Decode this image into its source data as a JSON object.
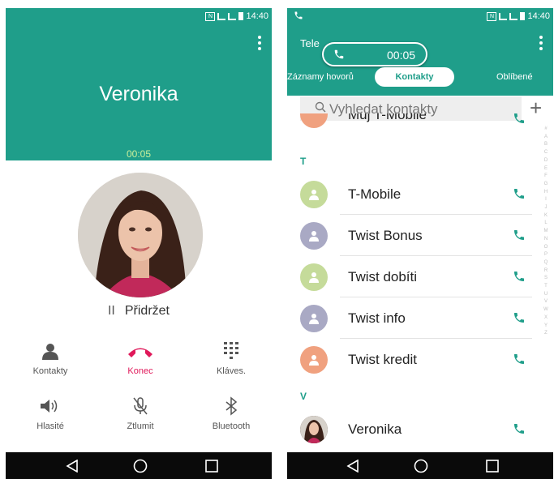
{
  "status": {
    "time": "14:40",
    "nfc": "N"
  },
  "call_screen": {
    "caller_name": "Veronika",
    "call_timer": "00:05",
    "hold_label": "Přidržet",
    "actions": [
      {
        "label": "Kontakty",
        "icon": "person-icon",
        "color": "#555555"
      },
      {
        "label": "Konec",
        "icon": "end-call-icon",
        "color": "#e0195a"
      },
      {
        "label": "Kláves.",
        "icon": "dialpad-icon",
        "color": "#555555"
      },
      {
        "label": "Hlasité",
        "icon": "speaker-icon",
        "color": "#555555"
      },
      {
        "label": "Ztlumit",
        "icon": "mute-mic-icon",
        "color": "#555555"
      },
      {
        "label": "Bluetooth",
        "icon": "bluetooth-icon",
        "color": "#555555"
      }
    ]
  },
  "contacts_screen": {
    "title": "Tele",
    "ongoing_call_timer": "00:05",
    "tabs": [
      "Záznamy hovorů",
      "Kontakty",
      "Oblíbené"
    ],
    "active_tab": "Kontakty",
    "search_placeholder": "Vyhledat kontakty",
    "partial_contact": "Můj T-Mobile",
    "sections": [
      {
        "letter": "T",
        "contacts": [
          {
            "name": "T-Mobile",
            "avatar_color": "#c5db9a"
          },
          {
            "name": "Twist Bonus",
            "avatar_color": "#a9a9c4"
          },
          {
            "name": "Twist dobíti",
            "avatar_color": "#c5db9a"
          },
          {
            "name": "Twist info",
            "avatar_color": "#a9a9c4"
          },
          {
            "name": "Twist kredit",
            "avatar_color": "#f0a17f"
          }
        ]
      },
      {
        "letter": "V",
        "contacts": [
          {
            "name": "Veronika",
            "avatar_color": "photo"
          }
        ]
      }
    ],
    "index_letters": [
      "#",
      "A",
      "B",
      "C",
      "D",
      "E",
      "F",
      "G",
      "H",
      "I",
      "J",
      "K",
      "L",
      "M",
      "N",
      "O",
      "P",
      "Q",
      "R",
      "S",
      "T",
      "U",
      "V",
      "W",
      "X",
      "Y",
      "Z"
    ]
  },
  "colors": {
    "accent": "#1f9e8a",
    "end_call": "#e0195a",
    "timer": "#c9ef9a"
  }
}
